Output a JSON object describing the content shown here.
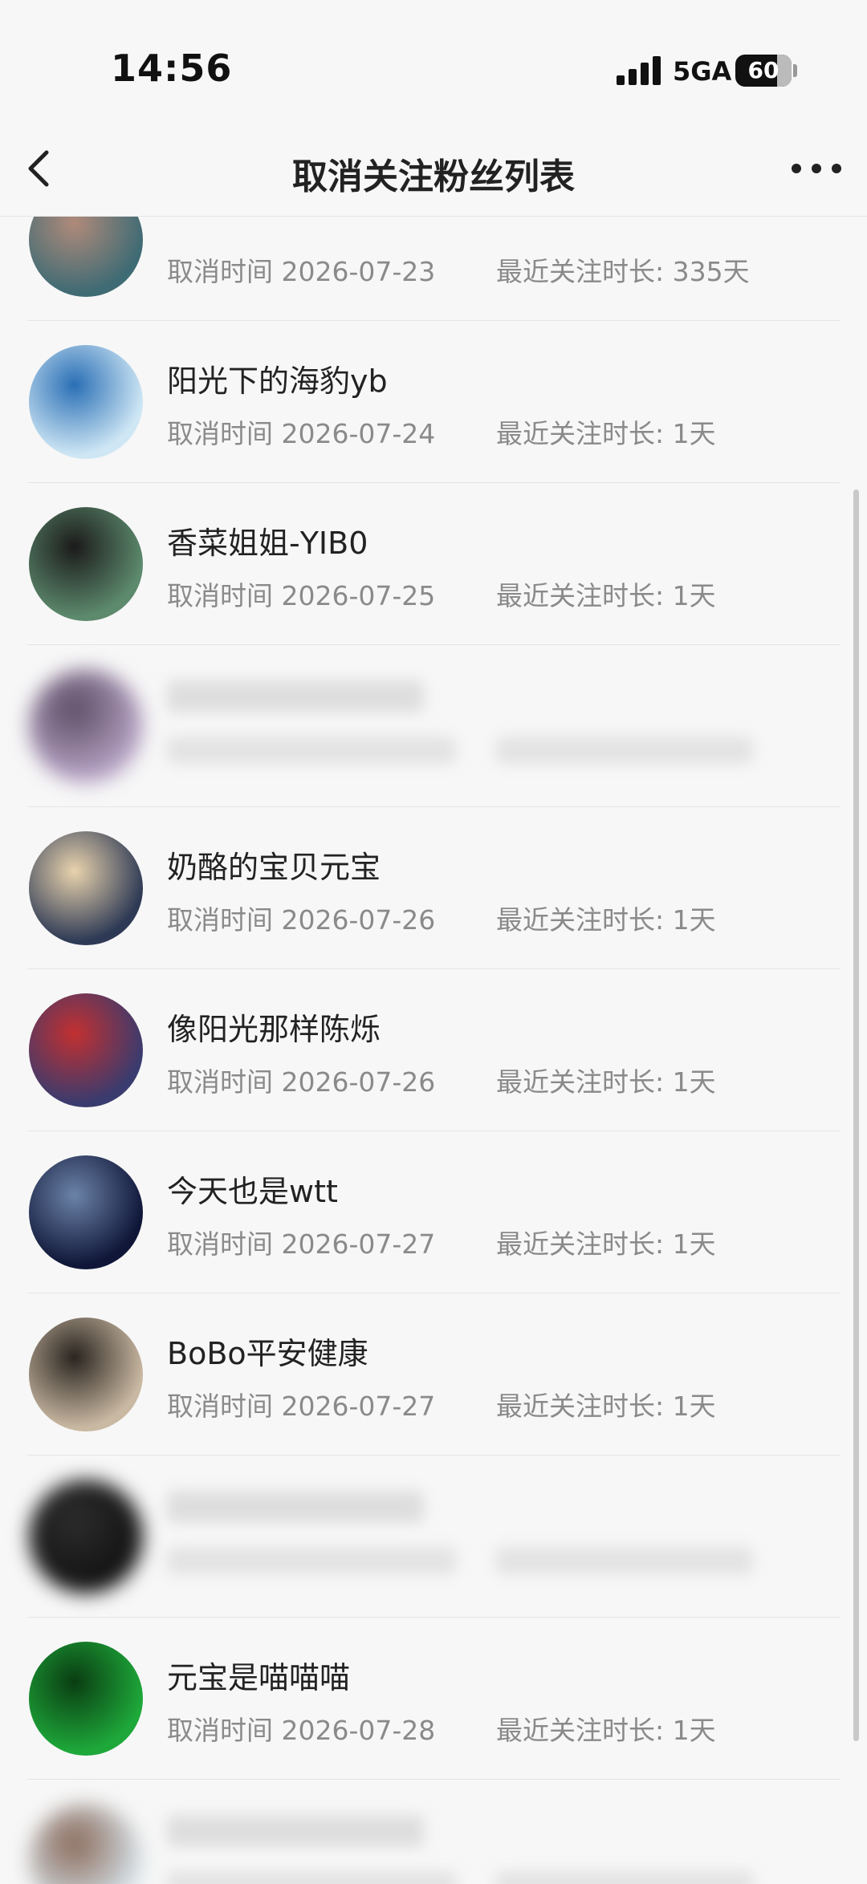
{
  "status_bar": {
    "time": "14:56",
    "network": "5GA",
    "battery": "60"
  },
  "nav": {
    "title": "取消关注粉丝列表",
    "back_icon": "chevron-left-icon",
    "more_icon": "more-dots-icon"
  },
  "rows": [
    {
      "name": "",
      "cancel": "取消时间 2026-07-23",
      "duration": "最近关注时长: 335天",
      "blurred": false,
      "partial": true,
      "avatar_colors": [
        "#3f6b74",
        "#b08a7a"
      ]
    },
    {
      "name": "阳光下的海豹yb",
      "cancel": "取消时间 2026-07-24",
      "duration": "最近关注时长: 1天",
      "blurred": false,
      "avatar_colors": [
        "#cfe7f5",
        "#2a6fb5"
      ]
    },
    {
      "name": "香菜姐姐-YIB0",
      "cancel": "取消时间 2026-07-25",
      "duration": "最近关注时长: 1天",
      "blurred": false,
      "avatar_colors": [
        "#5d8a6d",
        "#1b1b1b"
      ]
    },
    {
      "name": "",
      "cancel": "",
      "duration": "",
      "blurred": true,
      "avatar_colors": [
        "#b7a3c6",
        "#5c4d63"
      ]
    },
    {
      "name": "奶酪的宝贝元宝",
      "cancel": "取消时间 2026-07-26",
      "duration": "最近关注时长: 1天",
      "blurred": false,
      "avatar_colors": [
        "#2e3a55",
        "#e9d3ad"
      ]
    },
    {
      "name": "像阳光那样陈烁",
      "cancel": "取消时间 2026-07-26",
      "duration": "最近关注时长: 1天",
      "blurred": false,
      "avatar_colors": [
        "#3a3b6e",
        "#c23030"
      ]
    },
    {
      "name": "今天也是wtt",
      "cancel": "取消时间 2026-07-27",
      "duration": "最近关注时长: 1天",
      "blurred": false,
      "avatar_colors": [
        "#0f1638",
        "#6b83a8"
      ]
    },
    {
      "name": "BoBo平安健康",
      "cancel": "取消时间 2026-07-27",
      "duration": "最近关注时长: 1天",
      "blurred": false,
      "avatar_colors": [
        "#c9b8a2",
        "#2a2520"
      ]
    },
    {
      "name": "",
      "cancel": "",
      "duration": "",
      "blurred": true,
      "avatar_colors": [
        "#111111",
        "#2d2d2d"
      ]
    },
    {
      "name": "元宝是喵喵喵",
      "cancel": "取消时间 2026-07-28",
      "duration": "最近关注时长: 1天",
      "blurred": false,
      "avatar_colors": [
        "#1ea83a",
        "#0a3d12"
      ]
    },
    {
      "name": "",
      "cancel": "",
      "duration": "",
      "blurred": true,
      "avatar_colors": [
        "#d7e3ea",
        "#8a6a5a"
      ]
    }
  ]
}
